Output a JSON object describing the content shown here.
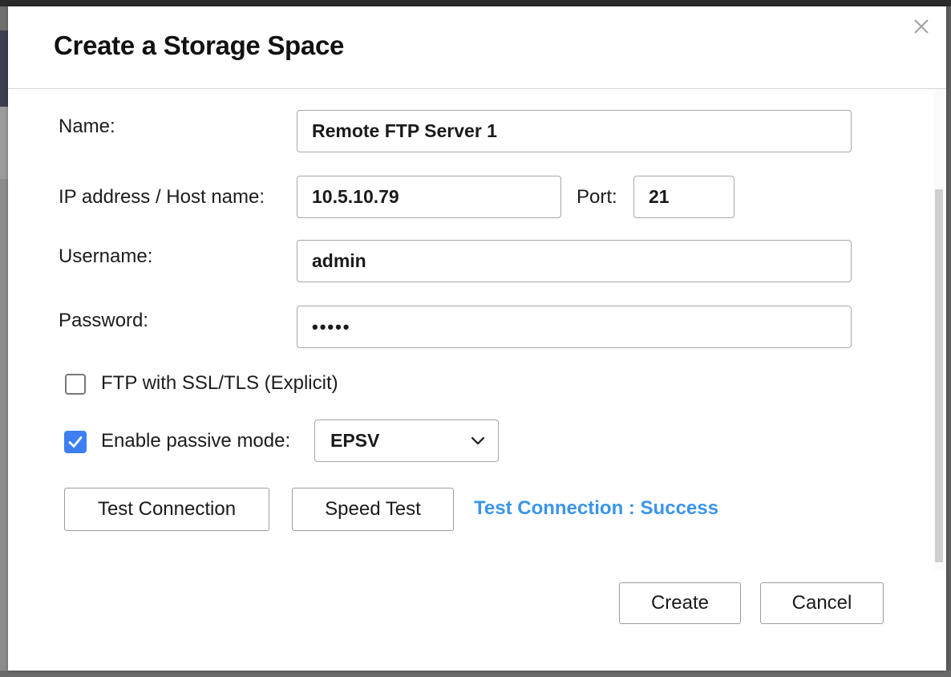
{
  "dialog": {
    "title": "Create a Storage Space",
    "close_icon": "close-icon"
  },
  "form": {
    "name": {
      "label": "Name:",
      "value": "Remote FTP Server 1"
    },
    "host": {
      "label": "IP address / Host name:",
      "value": "10.5.10.79"
    },
    "port": {
      "label": "Port:",
      "value": "21"
    },
    "username": {
      "label": "Username:",
      "value": "admin"
    },
    "password": {
      "label": "Password:",
      "value": "•••••"
    },
    "ssl": {
      "label": "FTP with SSL/TLS (Explicit)",
      "checked": false
    },
    "passive": {
      "label": "Enable passive mode:",
      "checked": true,
      "selected": "EPSV"
    }
  },
  "actions": {
    "test_connection": "Test Connection",
    "speed_test": "Speed Test",
    "status": "Test Connection : Success",
    "create": "Create",
    "cancel": "Cancel"
  },
  "colors": {
    "accent": "#3d7ff0",
    "status": "#3b95e8"
  }
}
